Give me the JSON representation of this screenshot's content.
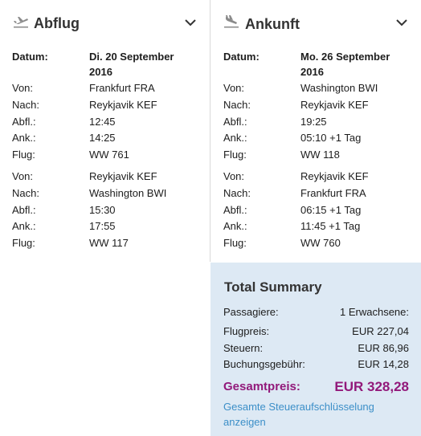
{
  "outbound": {
    "title": "Abflug",
    "date_label": "Datum:",
    "date_value_line1": "Di. 20 September",
    "date_value_line2": "2016",
    "segments": [
      {
        "from_label": "Von:",
        "from": "Frankfurt FRA",
        "to_label": "Nach:",
        "to": "Reykjavik KEF",
        "dep_label": "Abfl.:",
        "dep": "12:45",
        "arr_label": "Ank.:",
        "arr": "14:25",
        "flight_label": "Flug:",
        "flight": "WW 761"
      },
      {
        "from_label": "Von:",
        "from": "Reykjavik KEF",
        "to_label": "Nach:",
        "to": "Washington BWI",
        "dep_label": "Abfl.:",
        "dep": "15:30",
        "arr_label": "Ank.:",
        "arr": "17:55",
        "flight_label": "Flug:",
        "flight": "WW 117"
      }
    ]
  },
  "inbound": {
    "title": "Ankunft",
    "date_label": "Datum:",
    "date_value_line1": "Mo. 26 September",
    "date_value_line2": "2016",
    "segments": [
      {
        "from_label": "Von:",
        "from": "Washington BWI",
        "to_label": "Nach:",
        "to": "Reykjavik KEF",
        "dep_label": "Abfl.:",
        "dep": "19:25",
        "arr_label": "Ank.:",
        "arr": "05:10 +1 Tag",
        "flight_label": "Flug:",
        "flight": "WW 118"
      },
      {
        "from_label": "Von:",
        "from": "Reykjavik KEF",
        "to_label": "Nach:",
        "to": "Frankfurt FRA",
        "dep_label": "Abfl.:",
        "dep": "06:15 +1 Tag",
        "arr_label": "Ank.:",
        "arr": "11:45 +1 Tag",
        "flight_label": "Flug:",
        "flight": "WW 760"
      }
    ]
  },
  "summary": {
    "title": "Total Summary",
    "passengers_label": "Passagiere:",
    "passengers_value": "1 Erwachsene:",
    "fare_label": "Flugpreis:",
    "fare_value": "EUR 227,04",
    "taxes_label": "Steuern:",
    "taxes_value": "EUR 86,96",
    "booking_fee_label": "Buchungsgebühr:",
    "booking_fee_value": "EUR 14,28",
    "total_label": "Gesamtpreis:",
    "total_value": "EUR 328,28",
    "tax_breakdown_link": "Gesamte Steueraufschlüsselung anzeigen"
  },
  "icons": {
    "outbound": "plane-takeoff-icon",
    "inbound": "plane-landing-icon",
    "expand": "chevron-down-icon"
  },
  "colors": {
    "summary_bg": "#dde9f4",
    "total": "#92197a",
    "link": "#3c8fc8"
  }
}
